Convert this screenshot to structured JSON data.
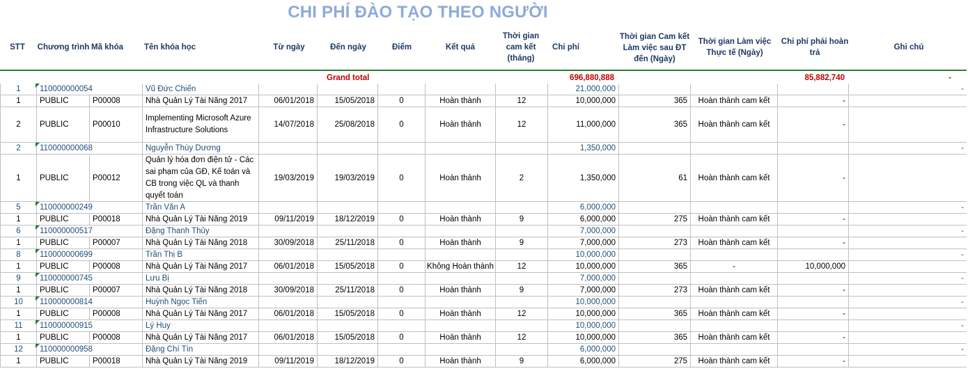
{
  "title": "CHI PHÍ ĐÀO TẠO THEO NGƯỜI",
  "headers": {
    "stt": "STT",
    "chuong_trinh": "Chương trình",
    "ma_khoa": "Mã khóa",
    "ten_khoa_hoc": "Tên khóa học",
    "tu_ngay": "Từ ngày",
    "den_ngay": "Đến ngày",
    "diem": "Điểm",
    "ket_qua": "Kết quả",
    "thoi_gian_cam_ket": "Thời gian cam kết (tháng)",
    "chi_phi": "Chi phí",
    "tg_cam_ket_sau_dt": "Thời gian Cam kết Làm việc sau ĐT đến (Ngày)",
    "tg_lam_viec_thuc_te": "Thời gian Làm việc Thực tế (Ngày)",
    "chi_phi_hoan_tra": "Chi phí phải hoàn trả",
    "ghi_chu": "Ghi chú"
  },
  "grand_total": {
    "label": "Grand total",
    "chi_phi": "696,880,888",
    "hoan_tra": "85,882,740",
    "ghi_chu": "-"
  },
  "groups": [
    {
      "person": {
        "stt": "1",
        "code": "110000000054",
        "name": "Vũ Đức Chiến",
        "chi_phi": "21,000,000",
        "ghi_chu": "-"
      },
      "courses": [
        {
          "stt": "1",
          "ct": "PUBLIC",
          "ma": "P00008",
          "ten": "Nhà Quản Lý Tài Năng 2017",
          "tu": "06/01/2018",
          "den": "15/05/2018",
          "diem": "0",
          "kq": "Hoàn thành",
          "tg": "12",
          "cp": "10,000,000",
          "ck": "365",
          "tt": "Hoàn thành cam kết",
          "ht": "-"
        },
        {
          "stt": "2",
          "ct": "PUBLIC",
          "ma": "P00010",
          "ten": "Implementing Microsoft Azure Infrastructure Solutions",
          "tu": "14/07/2018",
          "den": "25/08/2018",
          "diem": "0",
          "kq": "Hoàn thành",
          "tg": "12",
          "cp": "11,000,000",
          "ck": "365",
          "tt": "Hoàn thành cam kết",
          "ht": "-",
          "lines": 3
        }
      ]
    },
    {
      "person": {
        "stt": "2",
        "code": "110000000068",
        "name": "Nguyễn Thùy Dương",
        "chi_phi": "1,350,000",
        "ghi_chu": "-"
      },
      "courses": [
        {
          "stt": "1",
          "ct": "PUBLIC",
          "ma": "P00012",
          "ten": "Quản lý hóa đơn điện tử - Các sai phạm của GĐ, Kế toán và CB trong việc QL và thanh quyết toán",
          "tu": "19/03/2019",
          "den": "19/03/2019",
          "diem": "0",
          "kq": "Hoàn thành",
          "tg": "2",
          "cp": "1,350,000",
          "ck": "61",
          "tt": "Hoàn thành cam kết",
          "ht": "-",
          "lines": 4
        }
      ]
    },
    {
      "person": {
        "stt": "5",
        "code": "110000000249",
        "name": "Trần Văn A",
        "chi_phi": "6,000,000",
        "ghi_chu": "-"
      },
      "courses": [
        {
          "stt": "1",
          "ct": "PUBLIC",
          "ma": "P00018",
          "ten": "Nhà Quản Lý Tài Năng 2019",
          "tu": "09/11/2019",
          "den": "18/12/2019",
          "diem": "0",
          "kq": "Hoàn thành",
          "tg": "9",
          "cp": "6,000,000",
          "ck": "275",
          "tt": "Hoàn thành cam kết",
          "ht": "-"
        }
      ]
    },
    {
      "person": {
        "stt": "6",
        "code": "110000000517",
        "name": "Đặng Thanh Thủy",
        "chi_phi": "7,000,000",
        "ghi_chu": "-"
      },
      "courses": [
        {
          "stt": "1",
          "ct": "PUBLIC",
          "ma": "P00007",
          "ten": "Nhà Quản Lý Tài Năng 2018",
          "tu": "30/09/2018",
          "den": "25/11/2018",
          "diem": "0",
          "kq": "Hoàn thành",
          "tg": "9",
          "cp": "7,000,000",
          "ck": "273",
          "tt": "Hoàn thành cam kết",
          "ht": "-"
        }
      ]
    },
    {
      "person": {
        "stt": "8",
        "code": "110000000699",
        "name": "Trần Thị B",
        "chi_phi": "10,000,000",
        "ghi_chu": "-"
      },
      "courses": [
        {
          "stt": "1",
          "ct": "PUBLIC",
          "ma": "P00008",
          "ten": "Nhà Quản Lý Tài Năng 2017",
          "tu": "06/01/2018",
          "den": "15/05/2018",
          "diem": "0",
          "kq": "Không Hoàn thành",
          "tg": "12",
          "cp": "10,000,000",
          "ck": "365",
          "tt": "-",
          "ht": "10,000,000"
        }
      ]
    },
    {
      "person": {
        "stt": "9",
        "code": "110000000745",
        "name": "Lưu Bị",
        "chi_phi": "7,000,000",
        "ghi_chu": "-"
      },
      "courses": [
        {
          "stt": "1",
          "ct": "PUBLIC",
          "ma": "P00007",
          "ten": "Nhà Quản Lý Tài Năng 2018",
          "tu": "30/09/2018",
          "den": "25/11/2018",
          "diem": "0",
          "kq": "Hoàn thành",
          "tg": "9",
          "cp": "7,000,000",
          "ck": "273",
          "tt": "Hoàn thành cam kết",
          "ht": "-"
        }
      ]
    },
    {
      "person": {
        "stt": "10",
        "code": "110000000814",
        "name": "Huỳnh Ngọc Tiến",
        "chi_phi": "10,000,000",
        "ghi_chu": "-"
      },
      "courses": [
        {
          "stt": "1",
          "ct": "PUBLIC",
          "ma": "P00008",
          "ten": "Nhà Quản Lý Tài Năng 2017",
          "tu": "06/01/2018",
          "den": "15/05/2018",
          "diem": "0",
          "kq": "Hoàn thành",
          "tg": "12",
          "cp": "10,000,000",
          "ck": "365",
          "tt": "Hoàn thành cam kết",
          "ht": "-"
        }
      ]
    },
    {
      "person": {
        "stt": "11",
        "code": "110000000915",
        "name": "Lý Huy",
        "chi_phi": "10,000,000",
        "ghi_chu": "-"
      },
      "courses": [
        {
          "stt": "1",
          "ct": "PUBLIC",
          "ma": "P00008",
          "ten": "Nhà Quản Lý Tài Năng 2017",
          "tu": "06/01/2018",
          "den": "15/05/2018",
          "diem": "0",
          "kq": "Hoàn thành",
          "tg": "12",
          "cp": "10,000,000",
          "ck": "365",
          "tt": "Hoàn thành cam kết",
          "ht": "-"
        }
      ]
    },
    {
      "person": {
        "stt": "12",
        "code": "110000000958",
        "name": "Đặng Chí Tín",
        "chi_phi": "6,000,000",
        "ghi_chu": "-"
      },
      "courses": [
        {
          "stt": "1",
          "ct": "PUBLIC",
          "ma": "P00018",
          "ten": "Nhà Quản Lý Tài Năng 2019",
          "tu": "09/11/2019",
          "den": "18/12/2019",
          "diem": "0",
          "kq": "Hoàn thành",
          "tg": "9",
          "cp": "6,000,000",
          "ck": "275",
          "tt": "Hoàn thành cam kết",
          "ht": "-"
        }
      ]
    }
  ]
}
